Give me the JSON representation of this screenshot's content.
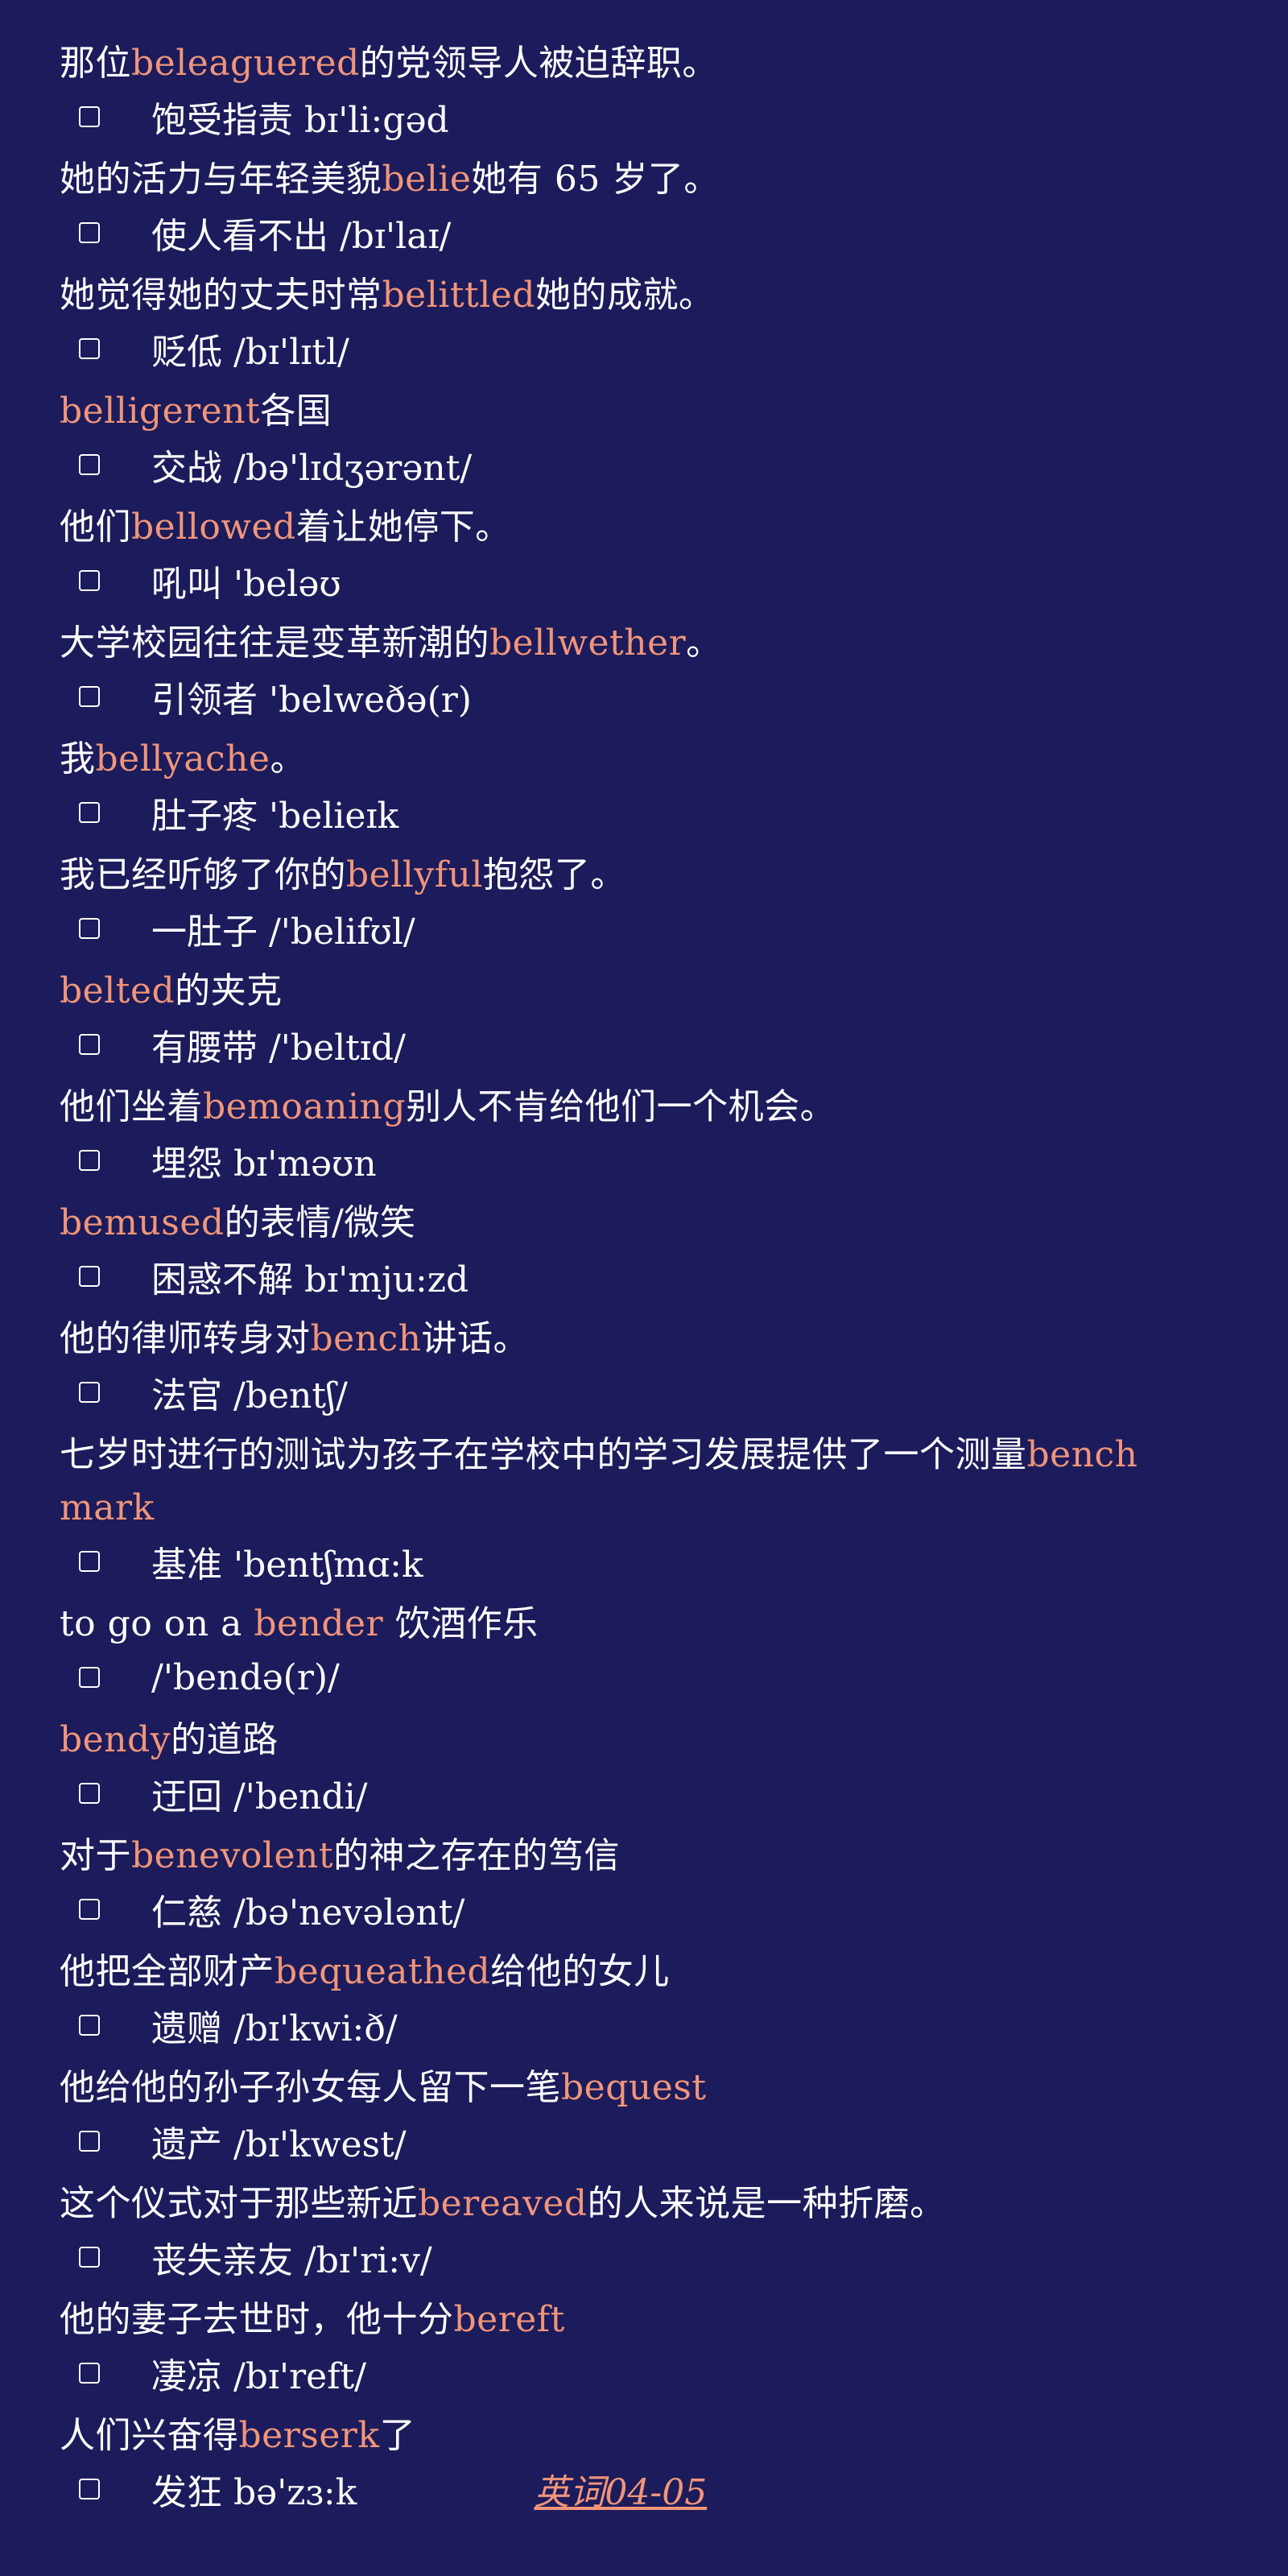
{
  "entries": [
    {
      "before": "那位",
      "word": "beleaguered",
      "after": "的党领导人被迫辞职。",
      "definition": "饱受指责 bɪ'li:gəd"
    },
    {
      "before": "她的活力与年轻美貌",
      "word": "belie",
      "after": "她有 65 岁了。",
      "definition": "使人看不出 /bɪ'laɪ/"
    },
    {
      "before": "她觉得她的丈夫时常",
      "word": "belittled",
      "after": "她的成就。",
      "definition": "贬低 /bɪ'lɪtl/"
    },
    {
      "before": "",
      "word": "belligerent",
      "after": "各国",
      "definition": "交战 /bə'lɪdʒərənt/"
    },
    {
      "before": "他们",
      "word": "bellowed",
      "after": "着让她停下。",
      "definition": "吼叫 'beləʊ"
    },
    {
      "before": "大学校园往往是变革新潮的",
      "word": "bellwether",
      "after": "。",
      "definition": "引领者 'belweðə(r)"
    },
    {
      "before": "我",
      "word": "bellyache",
      "after": "。",
      "definition": "肚子疼 'belieɪk"
    },
    {
      "before": "我已经听够了你的",
      "word": "bellyful",
      "after": "抱怨了。",
      "definition": "一肚子 /'belifʊl/"
    },
    {
      "before": "",
      "word": "belted",
      "after": "的夹克",
      "definition": "有腰带 /'beltɪd/"
    },
    {
      "before": "他们坐着",
      "word": "bemoaning",
      "after": "别人不肯给他们一个机会。",
      "definition": "埋怨 bɪ'məʊn"
    },
    {
      "before": "",
      "word": "bemused",
      "after": "的表情/微笑",
      "definition": "困惑不解 bɪ'mju:zd"
    },
    {
      "before": "他的律师转身对",
      "word": "bench",
      "after": "讲话。",
      "definition": "法官 /bentʃ/"
    },
    {
      "before": "七岁时进行的测试为孩子在学校中的学习发展提供了一个测量",
      "word": "benchmark",
      "after": "",
      "definition": "基准 'bentʃmɑ:k"
    },
    {
      "before": "to go on a ",
      "word": "bender",
      "after": " 饮酒作乐",
      "definition": "/'bendə(r)/"
    },
    {
      "before": "",
      "word": "bendy",
      "after": "的道路",
      "definition": "迂回 /'bendi/"
    },
    {
      "before": "对于",
      "word": "benevolent",
      "after": "的神之存在的笃信",
      "definition": "仁慈 /bə'nevələnt/"
    },
    {
      "before": "他把全部财产",
      "word": "bequeathed",
      "after": "给他的女儿",
      "definition": "遗赠 /bɪ'kwi:ð/"
    },
    {
      "before": "他给他的孙子孙女每人留下一笔",
      "word": "bequest",
      "after": "",
      "definition": "遗产 /bɪ'kwest/"
    },
    {
      "before": "这个仪式对于那些新近",
      "word": "bereaved",
      "after": "的人来说是一种折磨。",
      "definition": "丧失亲友 /bɪ'ri:v/"
    },
    {
      "before": "他的妻子去世时，他十分",
      "word": "bereft",
      "after": "",
      "definition": "凄凉 /bɪ'reft/"
    },
    {
      "before": "人们兴奋得",
      "word": "berserk",
      "after": "了",
      "definition": "发狂 bə'zɜ:k",
      "link": "英词04-05"
    }
  ],
  "colors": {
    "background": "#1c1b5b",
    "text": "#ffffff",
    "highlight": "#f0957a"
  }
}
